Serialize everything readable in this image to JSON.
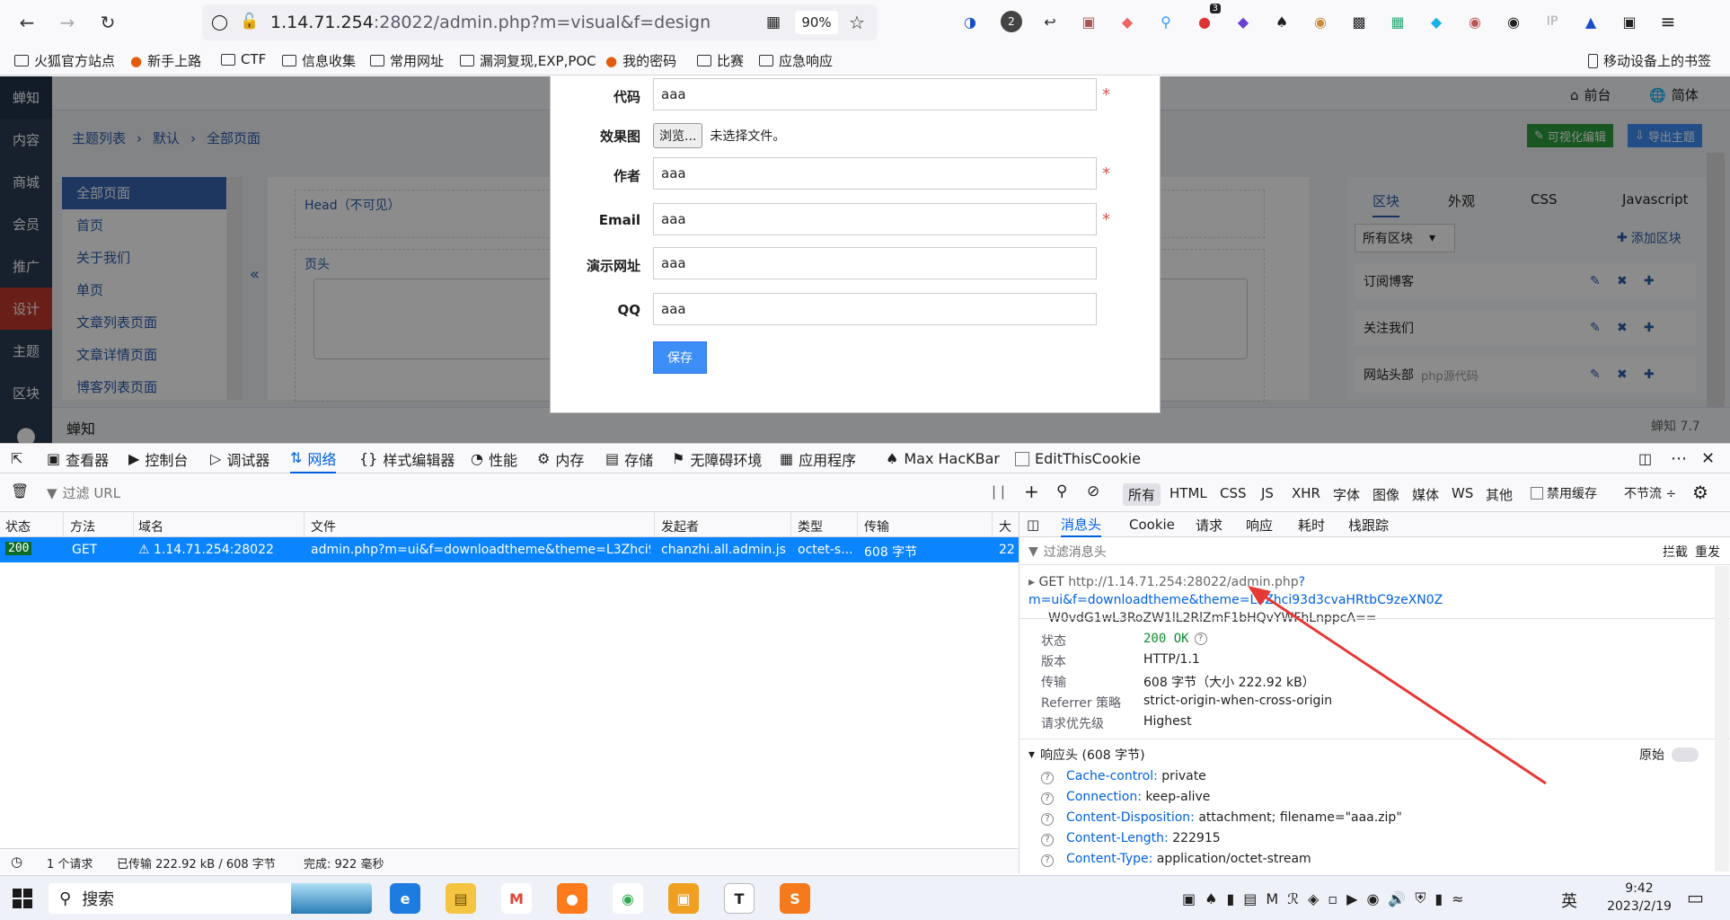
{
  "browser": {
    "url_host": "1.14.71.254",
    "url_path": ":28022/admin.php?m=visual&f=design",
    "zoom": "90%",
    "ext_badge_1": "2",
    "ext_badge_2": "3",
    "ext_ip": "IP"
  },
  "bookmarks": [
    {
      "label": "火狐官方站点",
      "icon": "folder"
    },
    {
      "label": "新手上路",
      "icon": "firefox"
    },
    {
      "label": "CTF",
      "icon": "folder"
    },
    {
      "label": "信息收集",
      "icon": "folder"
    },
    {
      "label": "常用网址",
      "icon": "folder"
    },
    {
      "label": "漏洞复现,EXP,POC",
      "icon": "folder"
    },
    {
      "label": "我的密码",
      "icon": "firefox"
    },
    {
      "label": "比赛",
      "icon": "folder"
    },
    {
      "label": "应急响应",
      "icon": "folder"
    }
  ],
  "mobile_bookmarks": "移动设备上的书签",
  "page": {
    "leftnav": [
      "蝉知",
      "内容",
      "商城",
      "会员",
      "推广",
      "设计",
      "主题",
      "区块"
    ],
    "top_right": {
      "front": "前台",
      "lang": "简体"
    },
    "breadcrumb": [
      "主题列表",
      "默认",
      "全部页面"
    ],
    "toolbar_buttons": {
      "visual_edit": "可视化编辑",
      "export": "导出主题"
    },
    "page_list": [
      "全部页面",
      "首页",
      "关于我们",
      "单页",
      "文章列表页面",
      "文章详情页面",
      "博客列表页面"
    ],
    "canvas_labels": {
      "head": "Head（不可见）",
      "header": "页头"
    },
    "collapse": "«",
    "right_tabs": [
      "区块",
      "外观",
      "CSS",
      "Javascript"
    ],
    "block_select": "所有区块",
    "add_block": "添加区块",
    "blocks": [
      {
        "name": "订阅博客",
        "note": ""
      },
      {
        "name": "关注我们",
        "note": ""
      },
      {
        "name": "网站头部",
        "note": "php源代码"
      }
    ],
    "footer_brand": "蝉知",
    "footer_right": "蝉知 7.7"
  },
  "modal": {
    "fields": [
      {
        "label": "代码",
        "value": "aaa",
        "required": true
      },
      {
        "label": "作者",
        "value": "aaa",
        "required": true
      },
      {
        "label": "Email",
        "value": "aaa",
        "required": true
      },
      {
        "label": "演示网址",
        "value": "aaa",
        "required": false
      },
      {
        "label": "QQ",
        "value": "aaa",
        "required": false
      }
    ],
    "preview_label": "效果图",
    "browse_button": "浏览...",
    "no_file": "未选择文件。",
    "save_button": "保存",
    "required_mark": "*"
  },
  "devtools": {
    "tabs": [
      "查看器",
      "控制台",
      "调试器",
      "网络",
      "样式编辑器",
      "性能",
      "内存",
      "存储",
      "无障碍环境",
      "应用程序",
      "Max HacKBar",
      "EditThisCookie"
    ],
    "active_tab": "网络",
    "filter_placeholder": "过滤 URL",
    "pause": "| |",
    "types": [
      "所有",
      "HTML",
      "CSS",
      "JS",
      "XHR",
      "字体",
      "图像",
      "媒体",
      "WS",
      "其他"
    ],
    "disable_cache": "禁用缓存",
    "throttle": "不节流 ÷",
    "columns": [
      "状态",
      "方法",
      "域名",
      "文件",
      "发起者",
      "类型",
      "传输",
      "大"
    ],
    "request": {
      "status": "200",
      "method": "GET",
      "domain": "1.14.71.254:28022",
      "file": "admin.php?m=ui&f=downloadtheme&theme=L3Zhci93d3",
      "initiator": "chanzhi.all.admin.js...",
      "type": "octet-s...",
      "transferred": "608 字节",
      "size": "22"
    },
    "statusbar": {
      "requests": "1 个请求",
      "transferred": "已传输 222.92 kB / 608 字节",
      "finish": "完成: 922 毫秒"
    },
    "detail_tabs": [
      "消息头",
      "Cookie",
      "请求",
      "响应",
      "耗时",
      "栈跟踪"
    ],
    "filter_headers": "过滤消息头",
    "block": "拦截",
    "resend": "重发",
    "request_line": {
      "method": "GET",
      "url_1_base": "http://1.14.71.254:28022/admin.php",
      "url_1_rest": "?m=ui&f=downloadtheme&theme=L3Zhci93d3cvaHRtbC9zeXN0Z",
      "url_2": "W0vdG1wL3RoZW1lL2RlZmF1bHQvYWFhLnppcA=="
    },
    "summary": [
      {
        "key": "状态",
        "value": "200 OK"
      },
      {
        "key": "版本",
        "value": "HTTP/1.1"
      },
      {
        "key": "传输",
        "value": "608 字节（大小 222.92 kB）"
      },
      {
        "key": "Referrer 策略",
        "value": "strict-origin-when-cross-origin"
      },
      {
        "key": "请求优先级",
        "value": "Highest"
      }
    ],
    "response_headers_title": "响应头 (608 字节)",
    "raw": "原始",
    "response_headers": [
      {
        "name": "Cache-control:",
        "value": "private"
      },
      {
        "name": "Connection:",
        "value": "keep-alive"
      },
      {
        "name": "Content-Disposition:",
        "value": "attachment; filename=\"aaa.zip\""
      },
      {
        "name": "Content-Length:",
        "value": "222915"
      },
      {
        "name": "Content-Type:",
        "value": "application/octet-stream"
      }
    ]
  },
  "taskbar": {
    "search": "搜索",
    "ime": "英",
    "time": "9:42",
    "date": "2023/2/19"
  },
  "colors": {
    "accent": "#0a84ff",
    "green_button": "#2e9e3e",
    "blue_button": "#3e8ef7",
    "nav_dark": "#2b3c53",
    "arrow_red": "#e53935"
  }
}
